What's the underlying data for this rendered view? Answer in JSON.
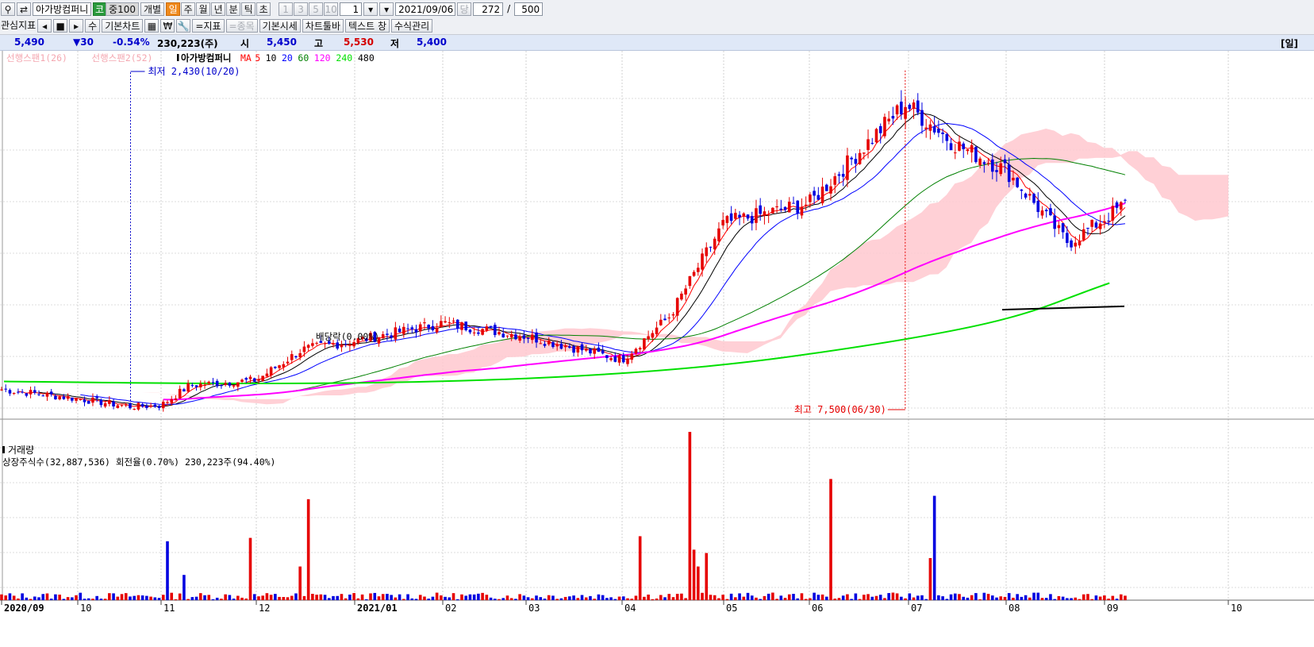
{
  "toolbar1": {
    "stock_name": "아가방컴퍼니",
    "market_badge": "코",
    "index_badge": "중100",
    "individual": "개별",
    "periods": [
      "일",
      "주",
      "월",
      "년",
      "분",
      "틱",
      "초"
    ],
    "active_period": "일",
    "intervals": [
      "1",
      "3",
      "5",
      "10"
    ],
    "interval_value": "1",
    "date": "2021/09/06",
    "count_prefix": "당",
    "count_value": "272",
    "count_sep": "/",
    "count_total": "500"
  },
  "toolbar2": {
    "watchlist": "관심지표",
    "stepper": "수",
    "basic_chart": "기본차트",
    "won": "₩",
    "indicator": "=지표",
    "item": "=종목",
    "basic_quote": "기본시세",
    "chart_toolbar": "차트툴바",
    "text_window": "텍스트 창",
    "formula_mgmt": "수식관리"
  },
  "quote": {
    "price": "5,490",
    "change": "▼30",
    "change_pct": "-0.54%",
    "volume": "230,223(주)",
    "open_label": "시",
    "open": "5,450",
    "high_label": "고",
    "high": "5,530",
    "low_label": "저",
    "low": "5,400",
    "right_tag": "[일]"
  },
  "colors": {
    "up": "#e60000",
    "down": "#0000e0",
    "cloud": "#ffc8cf",
    "ma5": "#ff0000",
    "ma10": "#000000",
    "ma20": "#0000ff",
    "ma60": "#008000",
    "ma120": "#ff00ff",
    "ma240": "#00e000",
    "ma480": "#000000"
  },
  "chart_data": {
    "type": "candlestick",
    "legend": {
      "span1": "선행스팬1(26)",
      "span2": "선행스팬2(52)",
      "name": "아가방컴퍼니",
      "ma_label": "MA",
      "periods": [
        "5",
        "10",
        "20",
        "60",
        "120",
        "240",
        "480"
      ]
    },
    "x_ticks": [
      "2020/09",
      "10",
      "11",
      "12",
      "2021/01",
      "02",
      "03",
      "04",
      "05",
      "06",
      "07",
      "08",
      "09",
      "10"
    ],
    "annotations": {
      "low": "최저 2,430(10/20)",
      "high": "최고 7,500(06/30)",
      "dividend": "배당락(0.00%)"
    },
    "ohlc_anchors": [
      {
        "date": "2020/09/01",
        "close": 2700
      },
      {
        "date": "2020/10/01",
        "close": 2560
      },
      {
        "date": "2020/10/20",
        "close": 2440
      },
      {
        "date": "2020/11/01",
        "close": 2460
      },
      {
        "date": "2020/11/10",
        "close": 2760
      },
      {
        "date": "2020/12/01",
        "close": 2840
      },
      {
        "date": "2020/12/15",
        "close": 3300
      },
      {
        "date": "2021/01/01",
        "close": 3430
      },
      {
        "date": "2021/02/01",
        "close": 3700
      },
      {
        "date": "2021/03/01",
        "close": 3500
      },
      {
        "date": "2021/04/01",
        "close": 3150
      },
      {
        "date": "2021/04/15",
        "close": 3800
      },
      {
        "date": "2021/05/01",
        "close": 5200
      },
      {
        "date": "2021/06/01",
        "close": 5500
      },
      {
        "date": "2021/06/30",
        "close": 7000
      },
      {
        "date": "2021/07/15",
        "close": 6400
      },
      {
        "date": "2021/08/01",
        "close": 6000
      },
      {
        "date": "2021/08/20",
        "close": 4900
      },
      {
        "date": "2021/09/06",
        "close": 5490
      }
    ],
    "ma240": [
      [
        2020.67,
        2850
      ],
      [
        2021.67,
        4300
      ]
    ],
    "ma480": [
      [
        2021.58,
        3900
      ],
      [
        2021.68,
        3950
      ]
    ],
    "volume_panel": {
      "title": "거래량",
      "info": "상장주식수(32,887,536) 회전율(0.70%) 230,223주(94.40%)"
    }
  }
}
